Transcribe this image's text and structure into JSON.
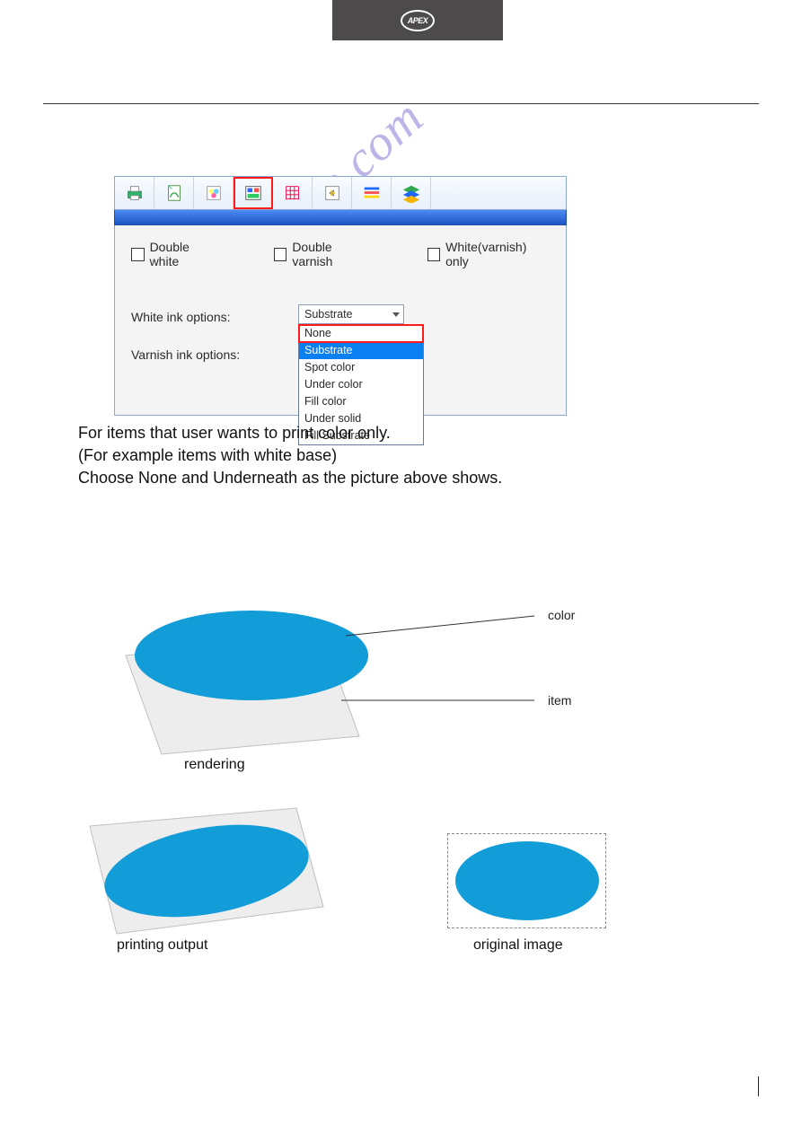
{
  "brand": {
    "logo_text": "APEX"
  },
  "toolbar": {
    "icons": [
      {
        "name": "print-setup-icon"
      },
      {
        "name": "page-icon"
      },
      {
        "name": "color-settings-icon"
      },
      {
        "name": "layout-icon"
      },
      {
        "name": "grid-icon"
      },
      {
        "name": "align-icon"
      },
      {
        "name": "stripes-icon"
      },
      {
        "name": "layers-icon"
      }
    ],
    "selected_index": 3
  },
  "panel": {
    "checkboxes": {
      "double_white": "Double white",
      "double_varnish": "Double varnish",
      "white_varnish_only": "White(varnish) only"
    },
    "labels": {
      "white_ink": "White ink options:",
      "varnish_ink": "Varnish ink options:"
    },
    "white_ink_selected": "Substrate",
    "dropdown_options": [
      {
        "label": "None",
        "red_outline": true
      },
      {
        "label": "Substrate",
        "highlighted": true
      },
      {
        "label": "Spot color"
      },
      {
        "label": "Under color"
      },
      {
        "label": "Fill color"
      },
      {
        "label": "Under solid"
      },
      {
        "label": "Fill Substrate"
      }
    ]
  },
  "description": {
    "line1": "For items that user wants to print color only.",
    "line2": "(For example items with white base)",
    "line3": "Choose None and Underneath as the picture above shows."
  },
  "watermark": "manualshive.com",
  "diagram": {
    "color_label": "color",
    "item_label": "item",
    "rendering_caption": "rendering",
    "printing_caption": "printing output",
    "original_caption": "original image"
  },
  "colors": {
    "ellipse": "#129cd8",
    "plate_fill": "#ededed",
    "plate_stroke": "#bfbfbf"
  }
}
